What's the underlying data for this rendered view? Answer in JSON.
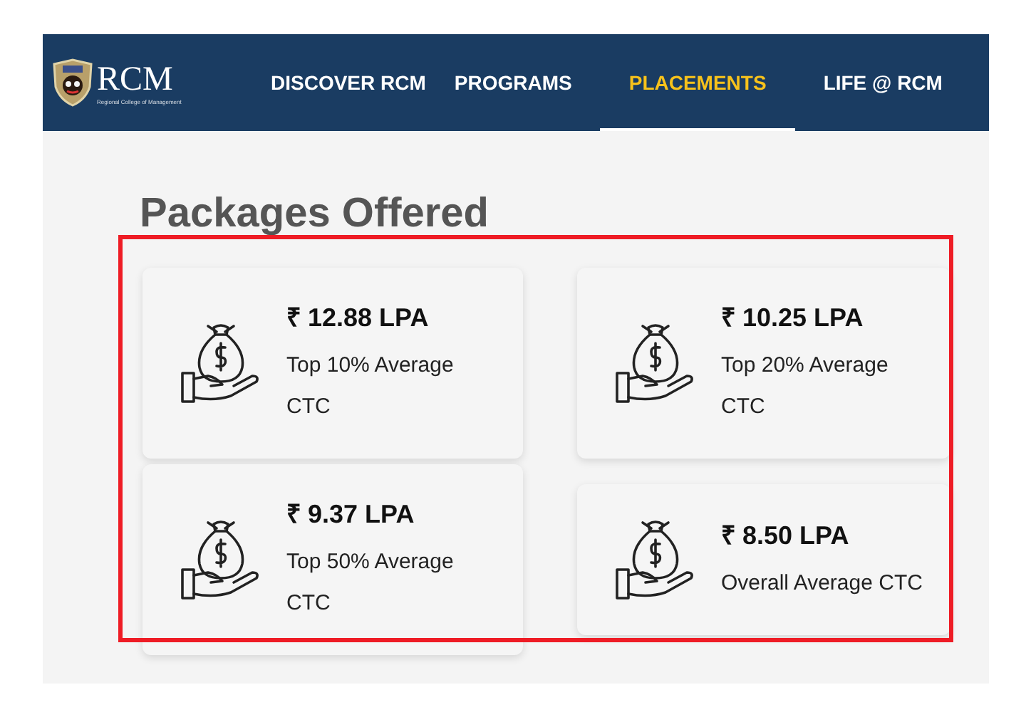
{
  "header": {
    "logo": {
      "text": "RCM",
      "subtitle": "Regional College of Management"
    },
    "nav": [
      {
        "label": "DISCOVER RCM",
        "selected": false
      },
      {
        "label": "PROGRAMS",
        "selected": false
      },
      {
        "label": "PLACEMENTS",
        "selected": true
      },
      {
        "label": "LIFE @ RCM",
        "selected": false
      }
    ]
  },
  "section": {
    "title": "Packages Offered",
    "cards": [
      {
        "value": "₹ 12.88 LPA",
        "label": "Top 10% Average CTC"
      },
      {
        "value": "₹ 10.25 LPA",
        "label": "Top 20% Average CTC"
      },
      {
        "value": "₹ 9.37 LPA",
        "label": "Top 50% Average CTC"
      },
      {
        "value": "₹ 8.50 LPA",
        "label": "Overall Average CTC"
      }
    ]
  }
}
